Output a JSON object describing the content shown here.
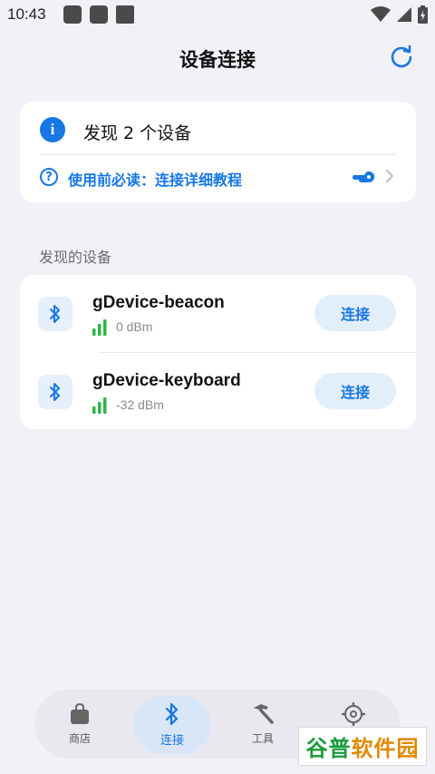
{
  "status_bar": {
    "time": "10:43"
  },
  "header": {
    "title": "设备连接"
  },
  "info_card": {
    "found_text": "发现 2 个设备",
    "help_text": "使用前必读：连接详细教程"
  },
  "section": {
    "label": "发现的设备"
  },
  "devices": [
    {
      "name": "gDevice-beacon",
      "rssi": "0 dBm",
      "connect_label": "连接"
    },
    {
      "name": "gDevice-keyboard",
      "rssi": "-32 dBm",
      "connect_label": "连接"
    }
  ],
  "bottom_nav": {
    "items": [
      {
        "label": "商店",
        "icon": "shopping-bag-icon"
      },
      {
        "label": "连接",
        "icon": "bluetooth-icon",
        "active": true
      },
      {
        "label": "工具",
        "icon": "hammer-icon"
      },
      {
        "label": "设置",
        "icon": "gear-icon"
      }
    ]
  },
  "watermark": {
    "part1": "谷普",
    "part2": "软件园"
  },
  "colors": {
    "accent": "#1677e5",
    "background": "#f2f1f8",
    "signal": "#2fb44a"
  }
}
